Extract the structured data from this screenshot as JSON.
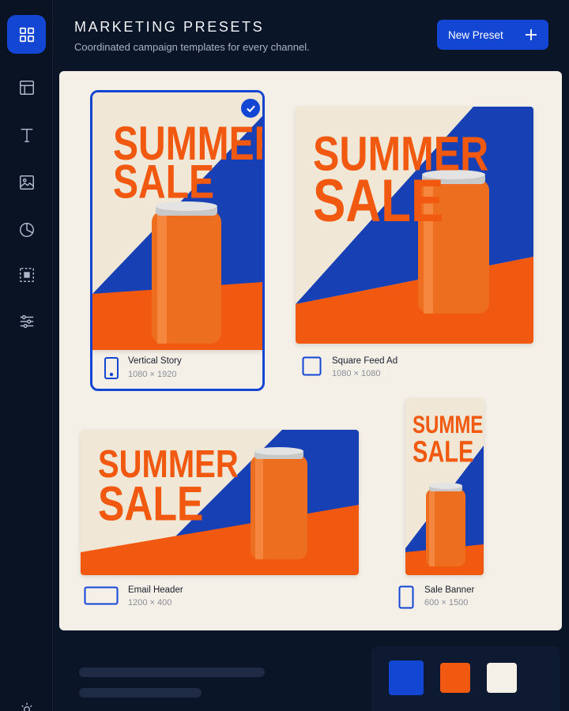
{
  "header": {
    "title": "MARKETING PRESETS",
    "subtitle": "Coordinated campaign templates for every channel.",
    "new_button_label": "New Preset"
  },
  "sidebar": {
    "items": [
      {
        "icon": "grid-icon",
        "active": true
      },
      {
        "icon": "layout-icon",
        "active": false
      },
      {
        "icon": "text-icon",
        "active": false
      },
      {
        "icon": "image-icon",
        "active": false
      },
      {
        "icon": "pie-chart-icon",
        "active": false
      },
      {
        "icon": "select-frame-icon",
        "active": false
      },
      {
        "icon": "sliders-icon",
        "active": false
      }
    ],
    "bottom_icon": "sun-icon"
  },
  "artwork": {
    "headline_line1": "SUMMER",
    "headline_line2": "SALE"
  },
  "presets": [
    {
      "name": "Vertical Story",
      "size": "1080 × 1920",
      "icon": "phone-icon",
      "selected": true
    },
    {
      "name": "Square Feed Ad",
      "size": "1080 × 1080",
      "icon": "square-icon",
      "selected": false
    },
    {
      "name": "Email Header",
      "size": "1200 × 400",
      "icon": "wide-rectangle-icon",
      "selected": false
    },
    {
      "name": "Sale Banner",
      "size": "600 × 1500",
      "icon": "tall-rectangle-icon",
      "selected": false
    }
  ],
  "palette": {
    "swatches": [
      "#1446d4",
      "#f0590f",
      "#f4efe7"
    ]
  },
  "colors": {
    "accent": "#1446d4",
    "orange": "#f0590f",
    "cream": "#f4efe7",
    "navy_bg": "#0b1528"
  }
}
